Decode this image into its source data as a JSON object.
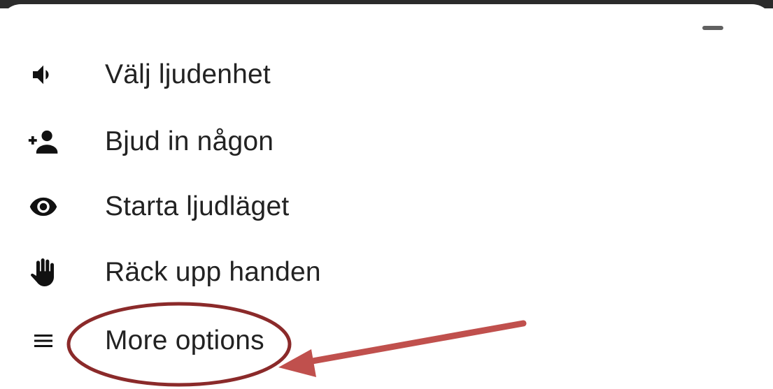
{
  "menu": {
    "items": [
      {
        "label": "Välj ljudenhet",
        "icon": "speaker-icon"
      },
      {
        "label": "Bjud in någon",
        "icon": "add-person-icon"
      },
      {
        "label": "Starta ljudläget",
        "icon": "eye-icon"
      },
      {
        "label": "Räck upp handen",
        "icon": "raised-hand-icon"
      },
      {
        "label": "More options",
        "icon": "menu-lines-icon"
      }
    ]
  },
  "annotation": {
    "highlight_color": "#8b2a2a",
    "arrow_color": "#c0504d"
  }
}
